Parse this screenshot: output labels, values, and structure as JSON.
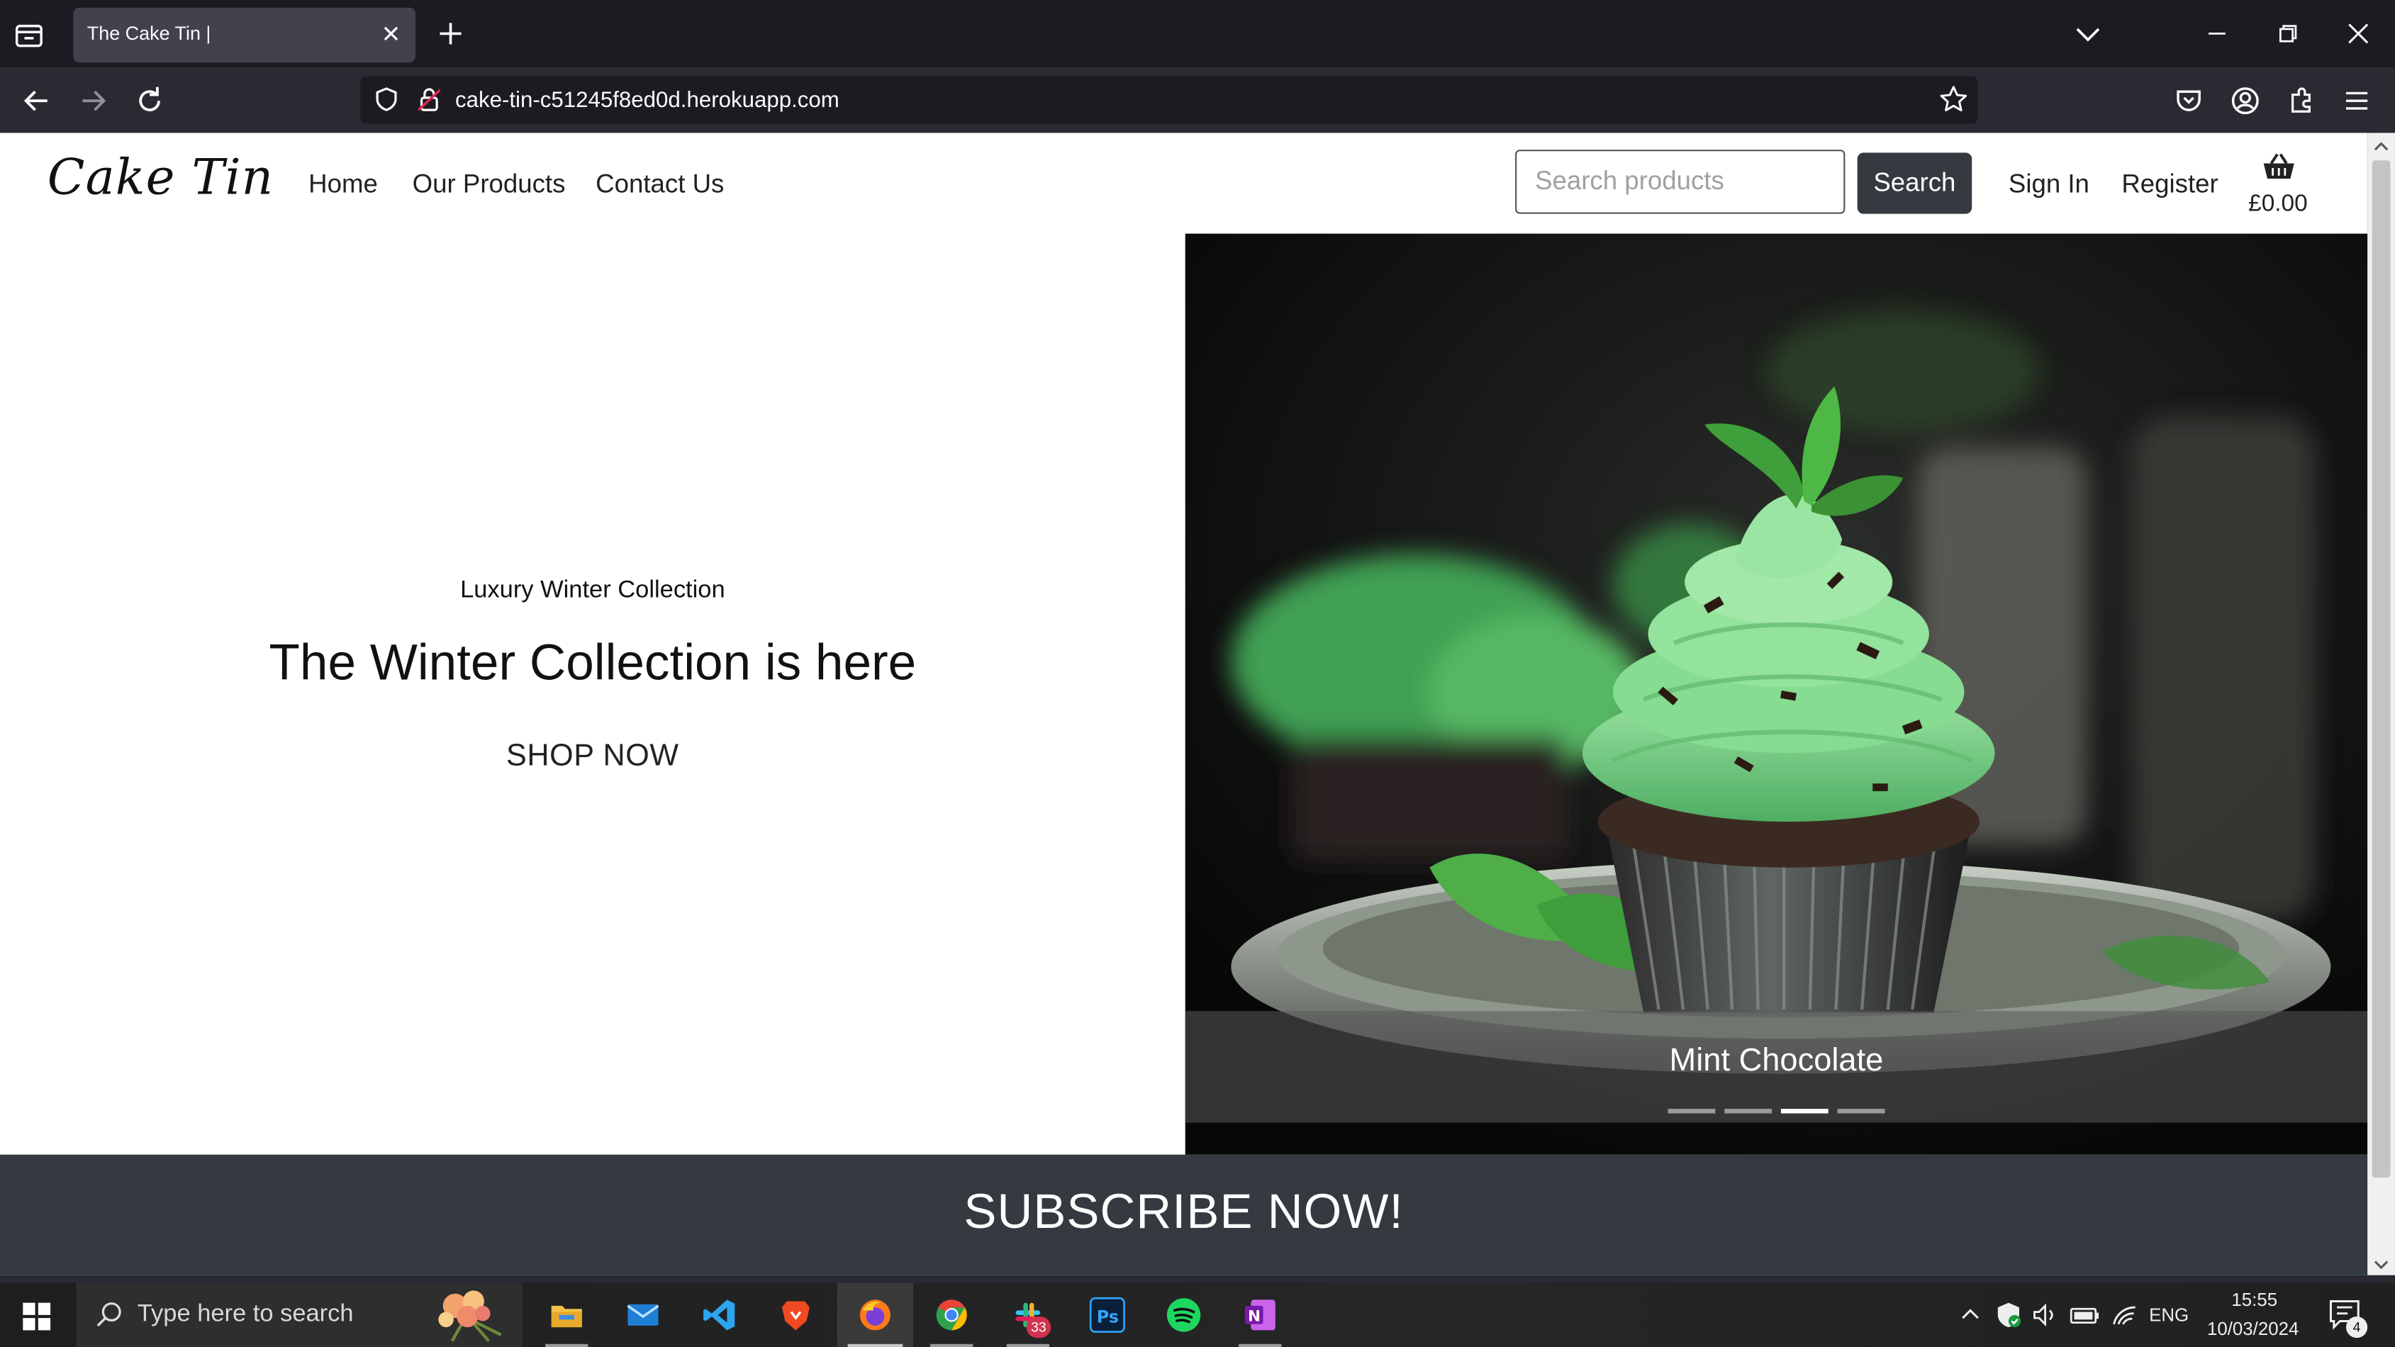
{
  "browser": {
    "tab_title": "The Cake Tin |",
    "url": "cake-tin-c51245f8ed0d.herokuapp.com"
  },
  "site": {
    "logo": "Cake Tin",
    "nav": [
      {
        "label": "Home"
      },
      {
        "label": "Our Products"
      },
      {
        "label": "Contact Us"
      }
    ],
    "search": {
      "placeholder": "Search products",
      "button": "Search"
    },
    "account": {
      "sign_in": "Sign In",
      "register": "Register"
    },
    "basket": {
      "total": "£0.00"
    }
  },
  "hero": {
    "eyebrow": "Luxury Winter Collection",
    "title": "The Winter Collection is here",
    "cta": "SHOP NOW",
    "carousel": {
      "caption": "Mint Chocolate",
      "slide_count": 4,
      "active_index": 2
    }
  },
  "subscribe": {
    "label": "SUBSCRIBE NOW!"
  },
  "taskbar": {
    "search_placeholder": "Type here to search",
    "apps": [
      "file-explorer",
      "mail",
      "vscode",
      "brave",
      "firefox",
      "chrome",
      "slack",
      "photoshop",
      "spotify",
      "onenote"
    ],
    "active_app": "firefox",
    "slack_badge": "33",
    "language": "ENG",
    "time": "15:55",
    "date": "10/03/2024",
    "notifications": "4"
  },
  "colors": {
    "chrome_dark": "#1c1b22",
    "toolbar": "#2b2a33",
    "tab_active": "#42414d",
    "button_dark": "#343a40",
    "frosting": "#7fdc8e"
  }
}
